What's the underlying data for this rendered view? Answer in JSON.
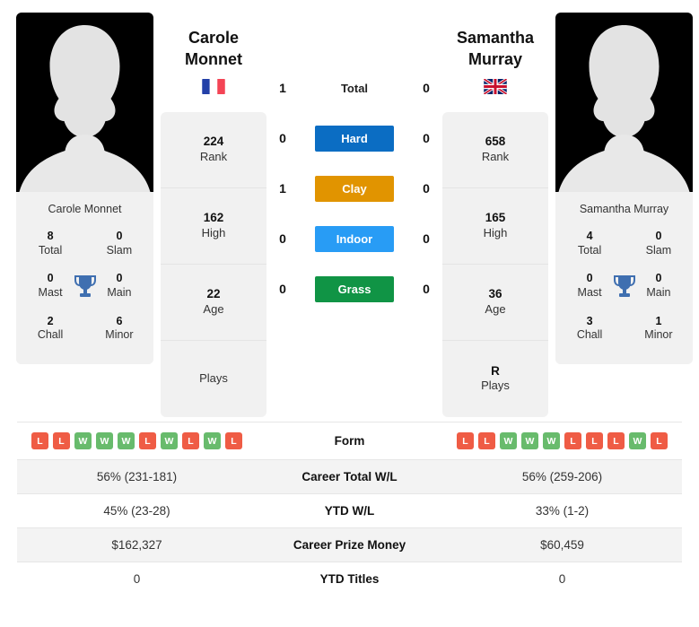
{
  "players": {
    "left": {
      "name": "Carole Monnet",
      "first_name": "Carole",
      "last_name": "Monnet",
      "country": "France",
      "flag": "fr-flag",
      "card_name": "Carole Monnet",
      "titles": [
        {
          "value": "8",
          "label": "Total"
        },
        {
          "value": "0",
          "label": "Slam"
        },
        {
          "value": "0",
          "label": "Mast"
        },
        {
          "value": "0",
          "label": "Main"
        },
        {
          "value": "2",
          "label": "Chall"
        },
        {
          "value": "6",
          "label": "Minor"
        }
      ],
      "rank_cells": [
        {
          "value": "224",
          "label": "Rank"
        },
        {
          "value": "162",
          "label": "High"
        },
        {
          "value": "22",
          "label": "Age"
        },
        {
          "value": "",
          "label": "Plays"
        }
      ],
      "form": [
        "L",
        "L",
        "W",
        "W",
        "W",
        "L",
        "W",
        "L",
        "W",
        "L"
      ],
      "career_total_wl": "56% (231-181)",
      "ytd_wl": "45% (23-28)",
      "career_prize_money": "$162,327",
      "ytd_titles": "0"
    },
    "right": {
      "name": "Samantha Murray",
      "first_name": "Samantha",
      "last_name": "Murray",
      "country": "United Kingdom",
      "flag": "gb-flag",
      "card_name": "Samantha Murray",
      "titles": [
        {
          "value": "4",
          "label": "Total"
        },
        {
          "value": "0",
          "label": "Slam"
        },
        {
          "value": "0",
          "label": "Mast"
        },
        {
          "value": "0",
          "label": "Main"
        },
        {
          "value": "3",
          "label": "Chall"
        },
        {
          "value": "1",
          "label": "Minor"
        }
      ],
      "rank_cells": [
        {
          "value": "658",
          "label": "Rank"
        },
        {
          "value": "165",
          "label": "High"
        },
        {
          "value": "36",
          "label": "Age"
        },
        {
          "value": "R",
          "label": "Plays"
        }
      ],
      "form": [
        "L",
        "L",
        "W",
        "W",
        "W",
        "L",
        "L",
        "L",
        "W",
        "L"
      ],
      "career_total_wl": "56% (259-206)",
      "ytd_wl": "33% (1-2)",
      "career_prize_money": "$60,459",
      "ytd_titles": "0"
    }
  },
  "h2h": [
    {
      "label": "Total",
      "left": "1",
      "right": "0",
      "color": "",
      "style": "plain"
    },
    {
      "label": "Hard",
      "left": "0",
      "right": "0",
      "color": "#0b6dc3",
      "style": "pill"
    },
    {
      "label": "Clay",
      "left": "1",
      "right": "0",
      "color": "#e19400",
      "style": "pill"
    },
    {
      "label": "Indoor",
      "left": "0",
      "right": "0",
      "color": "#289cf5",
      "style": "pill"
    },
    {
      "label": "Grass",
      "left": "0",
      "right": "0",
      "color": "#109445",
      "style": "pill"
    }
  ],
  "stats_rows": [
    {
      "label": "Form",
      "key": "form",
      "type": "form",
      "shaded": false
    },
    {
      "label": "Career Total W/L",
      "key": "career_total_wl",
      "type": "text",
      "shaded": true
    },
    {
      "label": "YTD W/L",
      "key": "ytd_wl",
      "type": "text",
      "shaded": false
    },
    {
      "label": "Career Prize Money",
      "key": "career_prize_money",
      "type": "text",
      "shaded": true
    },
    {
      "label": "YTD Titles",
      "key": "ytd_titles",
      "type": "text",
      "shaded": false
    }
  ],
  "colors": {
    "hard": "#0b6dc3",
    "clay": "#e19400",
    "indoor": "#289cf5",
    "grass": "#109445",
    "win_badge": "#68bb6c",
    "loss_badge": "#ef5c45",
    "trophy": "#3f6fb0",
    "card_bg": "#f1f1f1"
  }
}
